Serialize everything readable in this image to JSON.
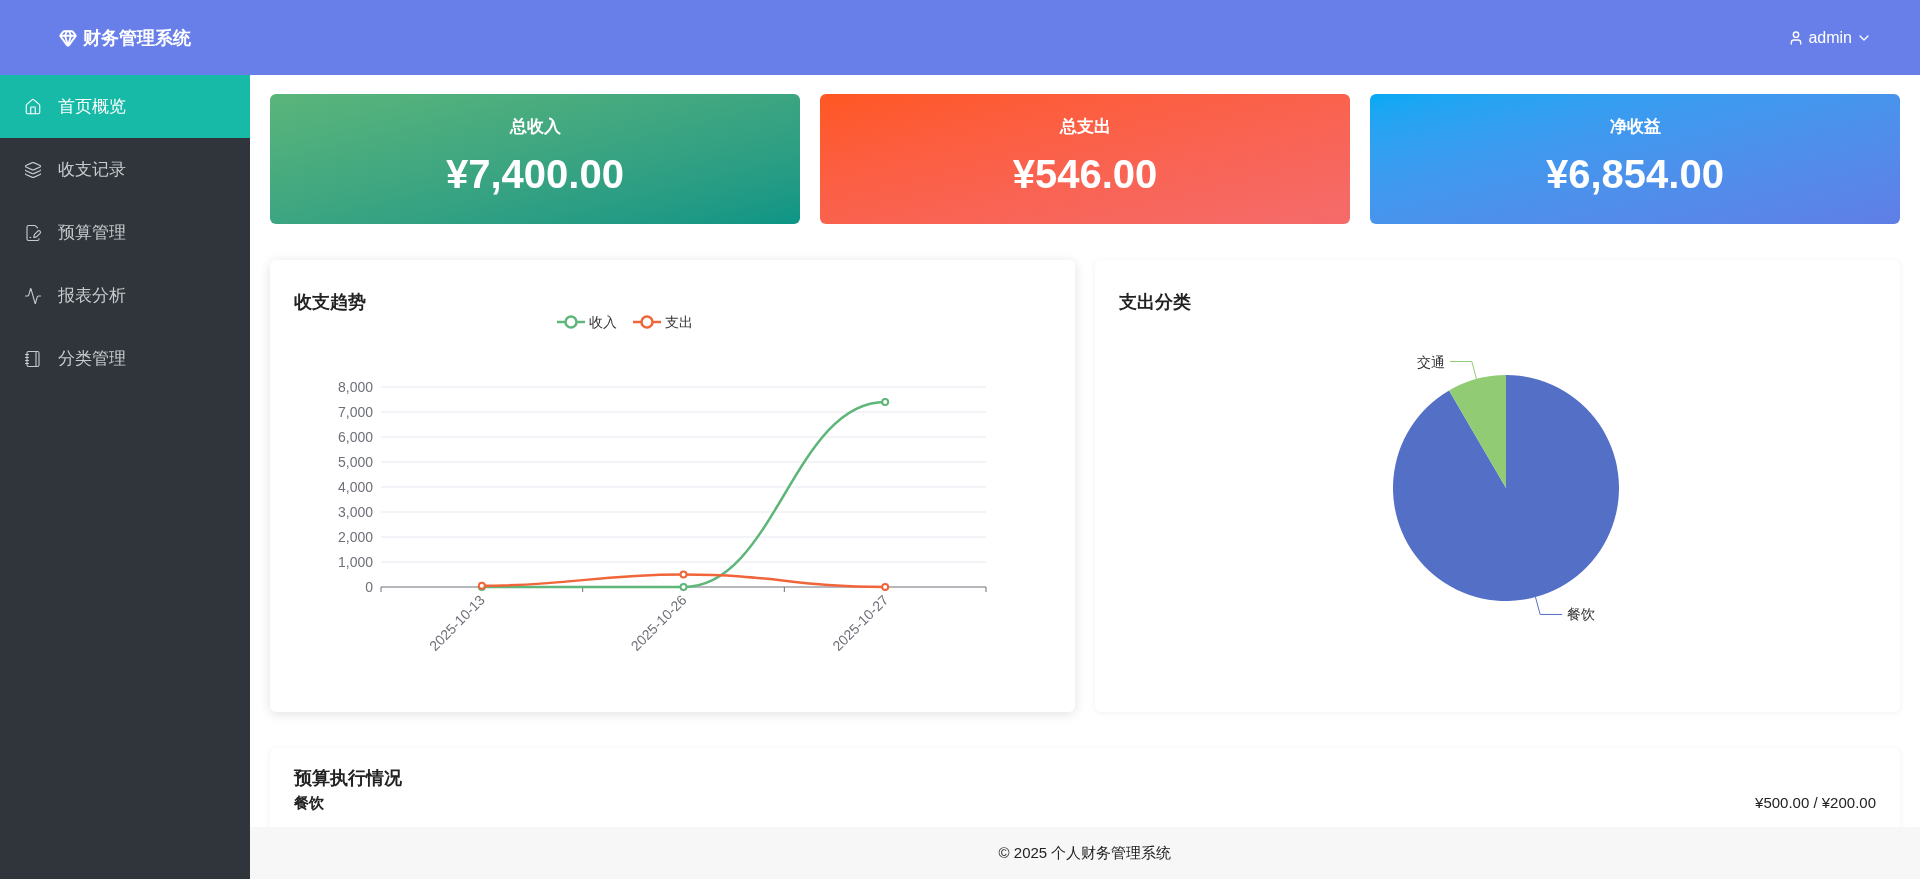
{
  "brand": {
    "title": "财务管理系统"
  },
  "sidebar": {
    "items": [
      {
        "label": "首页概览",
        "selected": true
      },
      {
        "label": "收支记录",
        "selected": false
      },
      {
        "label": "预算管理",
        "selected": false
      },
      {
        "label": "报表分析",
        "selected": false
      },
      {
        "label": "分类管理",
        "selected": false
      }
    ]
  },
  "header": {
    "user": "admin"
  },
  "stats": [
    {
      "label": "总收入",
      "value": "¥7,400.00",
      "kind": "income"
    },
    {
      "label": "总支出",
      "value": "¥546.00",
      "kind": "expense"
    },
    {
      "label": "净收益",
      "value": "¥6,854.00",
      "kind": "net"
    }
  ],
  "trend": {
    "title": "收支趋势",
    "chart_data": {
      "type": "line",
      "categories": [
        "2025-10-13",
        "2025-10-26",
        "2025-10-27"
      ],
      "ylim": [
        0,
        8000
      ],
      "grid": true,
      "yticks": [
        {
          "value": 0,
          "label": "0"
        },
        {
          "value": 1000,
          "label": "1,000"
        },
        {
          "value": 2000,
          "label": "2,000"
        },
        {
          "value": 3000,
          "label": "3,000"
        },
        {
          "value": 4000,
          "label": "4,000"
        },
        {
          "value": 5000,
          "label": "5,000"
        },
        {
          "value": 6000,
          "label": "6,000"
        },
        {
          "value": 7000,
          "label": "7,000"
        },
        {
          "value": 8000,
          "label": "8,000"
        }
      ],
      "series": [
        {
          "name": "收入",
          "color": "#5fb67a",
          "marker": true,
          "values": [
            0,
            0,
            7400
          ]
        },
        {
          "name": "支出",
          "color": "#f0653a",
          "marker": true,
          "values": [
            50,
            500,
            0
          ]
        }
      ]
    }
  },
  "expense_categories": {
    "title": "支出分类",
    "chart_data": {
      "type": "pie",
      "categories": [
        "餐饮",
        "交通"
      ],
      "values": [
        91.6,
        8.4
      ],
      "colors": [
        "#5470c6",
        "#91cc75"
      ]
    }
  },
  "budget": {
    "title": "预算执行情况",
    "items": [
      {
        "category": "餐饮",
        "amount": "¥500.00 / ¥200.00"
      }
    ]
  },
  "footer": "© 2025 个人财务管理系统"
}
